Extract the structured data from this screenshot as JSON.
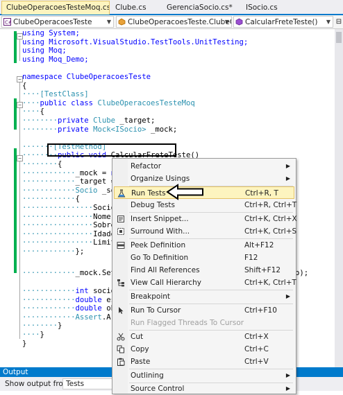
{
  "tabs": [
    {
      "label": "ClubeOperacoesTesteMoq.cs",
      "active": true,
      "close": "✕"
    },
    {
      "label": "Clube.cs",
      "active": false
    },
    {
      "label": "GerenciaSocio.cs*",
      "active": false
    },
    {
      "label": "ISocio.cs",
      "active": false
    }
  ],
  "nav": {
    "project": "ClubeOperacoesTeste",
    "class": "ClubeOperacoesTeste.ClubeOpe",
    "member": "CalcularFreteTeste()"
  },
  "code_lines": [
    [
      "using System;",
      "using Microsoft.VisualStudio.TestTools.UnitTesting;",
      "using Moq;",
      "using Moq_Demo;"
    ],
    [
      "namespace ClubeOperacoesTeste",
      "{",
      "[TestClass]",
      "public class ClubeOperacoesTesteMoq",
      "{",
      "private Clube _target;",
      "private Mock<ISocio> _mock;",
      "[TestMethod]",
      "public void CalcularFreteTeste()"
    ]
  ],
  "code": {
    "l1": "using System;",
    "l2": "using Microsoft.VisualStudio.TestTools.UnitTesting;",
    "l3": "using Moq;",
    "l4": "using Moq_Demo;",
    "l6": "namespace ClubeOperacoesTeste",
    "l7": "{",
    "l8": "[TestClass]",
    "l9a": "public class ",
    "l9b": "ClubeOperacoesTesteMoq",
    "l10": "{",
    "l11a": "private ",
    "l11b": "Clube",
    "l11c": " _target;",
    "l12a": "private ",
    "l12b": "Mock<ISocio>",
    "l12c": " _mock;",
    "l14": "[TestMethod]",
    "l15a": "public void ",
    "l15b": "CalcularFreteTeste()",
    "l16": "{",
    "l17a": "_mock = ",
    "l17b": "ne",
    "l18": "_target = ",
    "l19a": "Socio",
    "l19b": " _soc",
    "l20": "{",
    "l21": "SocioI",
    "l22": "Nome =",
    "l23": "Sobren",
    "l24": "Idade",
    "l25": "Limite",
    "l26": "};",
    "l28a": "_mock.Setu",
    "l28b": "o);",
    "l30a": "int ",
    "l30b": "socioI",
    "l31a": "double ",
    "l31b": "esp",
    "l32a": "double ",
    "l32b": "obt",
    "l33a": "Assert",
    "l33b": ".Are",
    "l34": "}",
    "l35": "}",
    "l36": "}"
  },
  "context_menu": {
    "items": [
      {
        "label": "Refactor",
        "shortcut": "",
        "submenu": true,
        "icon": ""
      },
      {
        "label": "Organize Usings",
        "shortcut": "",
        "submenu": true,
        "icon": ""
      },
      {
        "label": "Run Tests",
        "shortcut": "Ctrl+R, T",
        "submenu": false,
        "icon": "flask-icon",
        "highlighted": true
      },
      {
        "label": "Debug Tests",
        "shortcut": "Ctrl+R, Ctrl+T",
        "submenu": false,
        "icon": ""
      },
      {
        "label": "Insert Snippet...",
        "shortcut": "Ctrl+K, Ctrl+X",
        "submenu": false,
        "icon": "snippet-icon"
      },
      {
        "label": "Surround With...",
        "shortcut": "Ctrl+K, Ctrl+S",
        "submenu": false,
        "icon": "surround-icon"
      },
      {
        "label": "Peek Definition",
        "shortcut": "Alt+F12",
        "submenu": false,
        "icon": "peek-icon"
      },
      {
        "label": "Go To Definition",
        "shortcut": "F12",
        "submenu": false,
        "icon": ""
      },
      {
        "label": "Find All References",
        "shortcut": "Shift+F12",
        "submenu": false,
        "icon": ""
      },
      {
        "label": "View Call Hierarchy",
        "shortcut": "Ctrl+K, Ctrl+T",
        "submenu": false,
        "icon": "call-hierarchy-icon"
      },
      {
        "label": "Breakpoint",
        "shortcut": "",
        "submenu": true,
        "icon": ""
      },
      {
        "label": "Run To Cursor",
        "shortcut": "Ctrl+F10",
        "submenu": false,
        "icon": "cursor-icon"
      },
      {
        "label": "Run Flagged Threads To Cursor",
        "shortcut": "",
        "submenu": false,
        "icon": "",
        "disabled": true
      },
      {
        "label": "Cut",
        "shortcut": "Ctrl+X",
        "submenu": false,
        "icon": "scissors-icon"
      },
      {
        "label": "Copy",
        "shortcut": "Ctrl+C",
        "submenu": false,
        "icon": "copy-icon"
      },
      {
        "label": "Paste",
        "shortcut": "Ctrl+V",
        "submenu": false,
        "icon": "paste-icon"
      },
      {
        "label": "Outlining",
        "shortcut": "",
        "submenu": true,
        "icon": ""
      },
      {
        "label": "Source Control",
        "shortcut": "",
        "submenu": true,
        "icon": ""
      }
    ]
  },
  "output": {
    "title": "Output",
    "show_from_label": "Show output from:",
    "show_from_value": "Tests"
  },
  "colors": {
    "keyword": "#0000ff",
    "type": "#2b91af",
    "accent": "#007acc",
    "highlight": "#fdf4bf",
    "change_marker": "#00b050"
  }
}
